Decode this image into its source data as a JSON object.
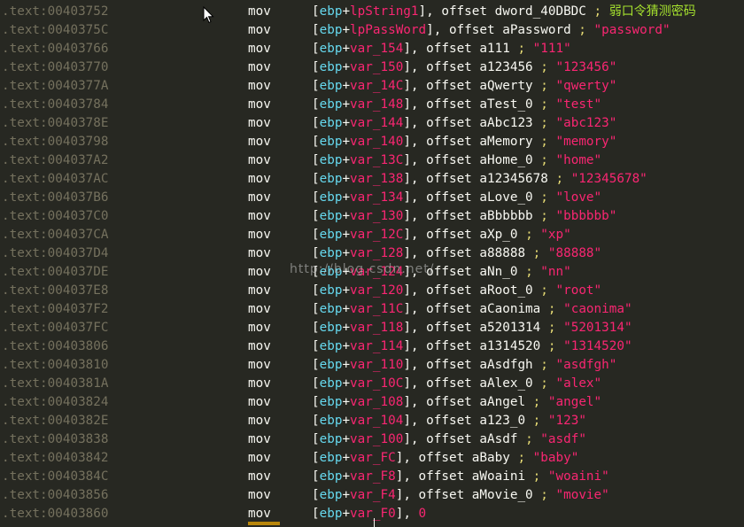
{
  "colors": {
    "background": "#272822",
    "address": "#75715e",
    "register": "#66d9ef",
    "variable": "#f92672",
    "comment_cn": "#a6e22e",
    "highlight": "#b8860b"
  },
  "watermark": "http://blog.csdn.net/",
  "rows": [
    {
      "addr": ".text:00403752",
      "mnem": "mov",
      "var": "lpString1",
      "sym": "dword_40DBDC",
      "cmt": "弱口令猜测密码",
      "ctype": "cn"
    },
    {
      "addr": ".text:0040375C",
      "mnem": "mov",
      "var": "lpPassWord",
      "sym": "aPassword",
      "cmt": "\"password\"",
      "ctype": "str"
    },
    {
      "addr": ".text:00403766",
      "mnem": "mov",
      "var": "var_154",
      "sym": "a111",
      "cmt": "\"111\"",
      "ctype": "str"
    },
    {
      "addr": ".text:00403770",
      "mnem": "mov",
      "var": "var_150",
      "sym": "a123456",
      "cmt": "\"123456\"",
      "ctype": "str"
    },
    {
      "addr": ".text:0040377A",
      "mnem": "mov",
      "var": "var_14C",
      "sym": "aQwerty",
      "cmt": "\"qwerty\"",
      "ctype": "str"
    },
    {
      "addr": ".text:00403784",
      "mnem": "mov",
      "var": "var_148",
      "sym": "aTest_0",
      "cmt": "\"test\"",
      "ctype": "str"
    },
    {
      "addr": ".text:0040378E",
      "mnem": "mov",
      "var": "var_144",
      "sym": "aAbc123",
      "cmt": "\"abc123\"",
      "ctype": "str"
    },
    {
      "addr": ".text:00403798",
      "mnem": "mov",
      "var": "var_140",
      "sym": "aMemory",
      "cmt": "\"memory\"",
      "ctype": "str"
    },
    {
      "addr": ".text:004037A2",
      "mnem": "mov",
      "var": "var_13C",
      "sym": "aHome_0",
      "cmt": "\"home\"",
      "ctype": "str"
    },
    {
      "addr": ".text:004037AC",
      "mnem": "mov",
      "var": "var_138",
      "sym": "a12345678",
      "cmt": "\"12345678\"",
      "ctype": "str"
    },
    {
      "addr": ".text:004037B6",
      "mnem": "mov",
      "var": "var_134",
      "sym": "aLove_0",
      "cmt": "\"love\"",
      "ctype": "str"
    },
    {
      "addr": ".text:004037C0",
      "mnem": "mov",
      "var": "var_130",
      "sym": "aBbbbbb",
      "cmt": "\"bbbbbb\"",
      "ctype": "str"
    },
    {
      "addr": ".text:004037CA",
      "mnem": "mov",
      "var": "var_12C",
      "sym": "aXp_0",
      "cmt": "\"xp\"",
      "ctype": "str"
    },
    {
      "addr": ".text:004037D4",
      "mnem": "mov",
      "var": "var_128",
      "sym": "a88888",
      "cmt": "\"88888\"",
      "ctype": "str"
    },
    {
      "addr": ".text:004037DE",
      "mnem": "mov",
      "var": "var_124",
      "sym": "aNn_0",
      "cmt": "\"nn\"",
      "ctype": "str"
    },
    {
      "addr": ".text:004037E8",
      "mnem": "mov",
      "var": "var_120",
      "sym": "aRoot_0",
      "cmt": "\"root\"",
      "ctype": "str"
    },
    {
      "addr": ".text:004037F2",
      "mnem": "mov",
      "var": "var_11C",
      "sym": "aCaonima",
      "cmt": "\"caonima\"",
      "ctype": "str"
    },
    {
      "addr": ".text:004037FC",
      "mnem": "mov",
      "var": "var_118",
      "sym": "a5201314",
      "cmt": "\"5201314\"",
      "ctype": "str"
    },
    {
      "addr": ".text:00403806",
      "mnem": "mov",
      "var": "var_114",
      "sym": "a1314520",
      "cmt": "\"1314520\"",
      "ctype": "str"
    },
    {
      "addr": ".text:00403810",
      "mnem": "mov",
      "var": "var_110",
      "sym": "aAsdfgh",
      "cmt": "\"asdfgh\"",
      "ctype": "str"
    },
    {
      "addr": ".text:0040381A",
      "mnem": "mov",
      "var": "var_10C",
      "sym": "aAlex_0",
      "cmt": "\"alex\"",
      "ctype": "str"
    },
    {
      "addr": ".text:00403824",
      "mnem": "mov",
      "var": "var_108",
      "sym": "aAngel",
      "cmt": "\"angel\"",
      "ctype": "str"
    },
    {
      "addr": ".text:0040382E",
      "mnem": "mov",
      "var": "var_104",
      "sym": "a123_0",
      "cmt": "\"123\"",
      "ctype": "str"
    },
    {
      "addr": ".text:00403838",
      "mnem": "mov",
      "var": "var_100",
      "sym": "aAsdf",
      "cmt": "\"asdf\"",
      "ctype": "str"
    },
    {
      "addr": ".text:00403842",
      "mnem": "mov",
      "var": "var_FC",
      "sym": "aBaby",
      "cmt": "\"baby\"",
      "ctype": "str"
    },
    {
      "addr": ".text:0040384C",
      "mnem": "mov",
      "var": "var_F8",
      "sym": "aWoaini",
      "cmt": "\"woaini\"",
      "ctype": "str"
    },
    {
      "addr": ".text:00403856",
      "mnem": "mov",
      "var": "var_F4",
      "sym": "aMovie_0",
      "cmt": "\"movie\"",
      "ctype": "str"
    },
    {
      "addr": ".text:00403860",
      "mnem": "mov",
      "var": "var_F0",
      "imm": "0"
    }
  ],
  "tokens": {
    "reg": "ebp",
    "offset": "offset",
    "lb": "[",
    "rb": "]",
    "plus": "+",
    "comma": ",",
    "semi": ";"
  }
}
